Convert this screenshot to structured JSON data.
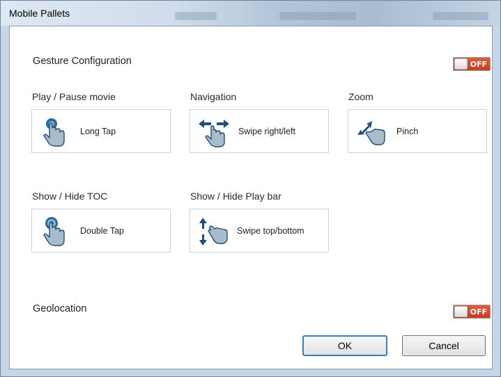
{
  "window": {
    "title": "Mobile Pallets"
  },
  "gesture_configuration": {
    "title": "Gesture Configuration",
    "toggle_state": "OFF",
    "groups": [
      {
        "label": "Play / Pause movie",
        "gesture": "Long Tap",
        "icon": "long-tap-icon"
      },
      {
        "label": "Navigation",
        "gesture": "Swipe right/left",
        "icon": "swipe-horizontal-icon"
      },
      {
        "label": "Zoom",
        "gesture": "Pinch",
        "icon": "pinch-icon"
      },
      {
        "label": "Show / Hide TOC",
        "gesture": "Double Tap",
        "icon": "double-tap-icon"
      },
      {
        "label": "Show / Hide Play bar",
        "gesture": "Swipe top/bottom",
        "icon": "swipe-vertical-icon"
      }
    ]
  },
  "geolocation": {
    "title": "Geolocation",
    "toggle_state": "OFF"
  },
  "buttons": {
    "ok": "OK",
    "cancel": "Cancel"
  },
  "colors": {
    "toggle_off": "#d2482b",
    "icon_blue": "#1f4e7a",
    "hand_fill": "#9fb3c2"
  }
}
